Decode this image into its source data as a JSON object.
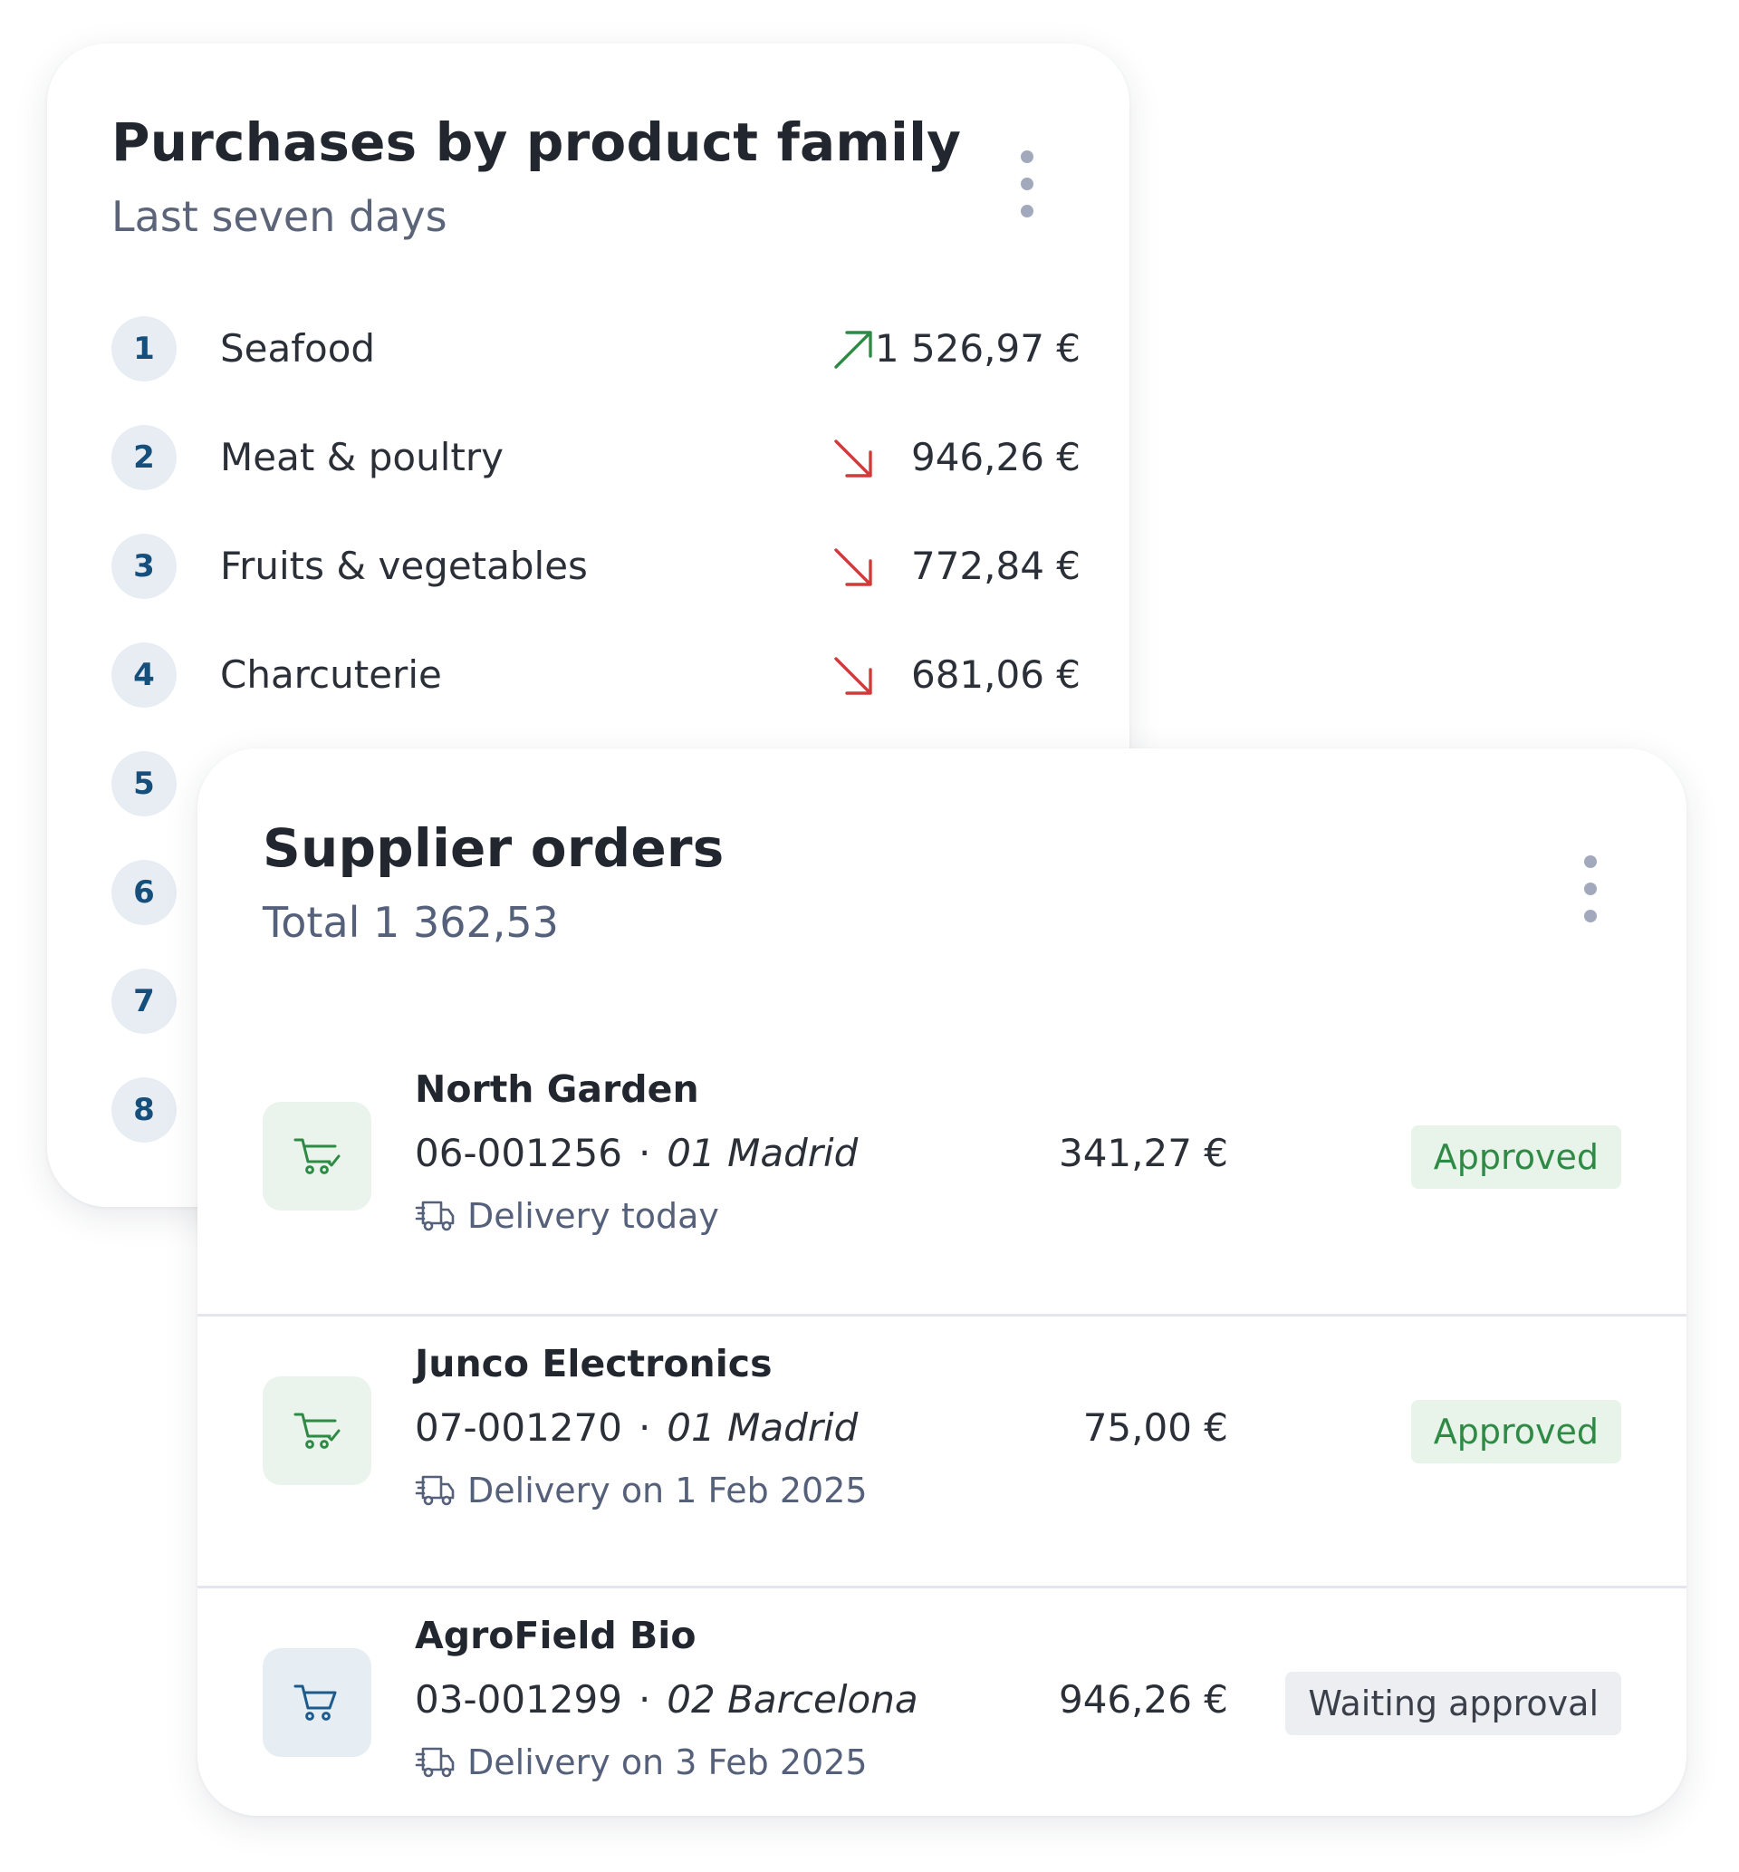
{
  "purchases": {
    "title": "Purchases by product family",
    "subtitle": "Last seven days",
    "items": [
      {
        "rank": "1",
        "name": "Seafood",
        "trend": "up",
        "amount": "1 526,97 €"
      },
      {
        "rank": "2",
        "name": "Meat & poultry",
        "trend": "down",
        "amount": "946,26 €"
      },
      {
        "rank": "3",
        "name": "Fruits & vegetables",
        "trend": "down",
        "amount": "772,84 €"
      },
      {
        "rank": "4",
        "name": "Charcuterie",
        "trend": "down",
        "amount": "681,06 €"
      },
      {
        "rank": "5"
      },
      {
        "rank": "6"
      },
      {
        "rank": "7"
      },
      {
        "rank": "8"
      }
    ]
  },
  "orders": {
    "title": "Supplier orders",
    "total": "Total 1 362,53",
    "items": [
      {
        "supplier": "North Garden",
        "number": "06-001256",
        "location": "01 Madrid",
        "delivery": "Delivery today",
        "amount": "341,27 €",
        "status": "Approved",
        "icon": "cart-check-icon"
      },
      {
        "supplier": "Junco Electronics",
        "number": "07-001270",
        "location": "01 Madrid",
        "delivery": "Delivery on 1 Feb 2025",
        "amount": "75,00 €",
        "status": "Approved",
        "icon": "cart-check-icon"
      },
      {
        "supplier": "AgroField Bio",
        "number": "03-001299",
        "location": "02 Barcelona",
        "delivery": "Delivery on 3 Feb 2025",
        "amount": "946,26 €",
        "status": "Waiting approval",
        "icon": "cart-icon"
      }
    ]
  },
  "separator": "·",
  "colors": {
    "trend_up": "#2e8a45",
    "trend_down": "#d23a3a",
    "approved_bg": "#e8f4ea",
    "approved_text": "#2e8a45",
    "waiting_bg": "#eceef2",
    "waiting_text": "#3a3f49",
    "rank_badge_bg": "#e8edf3",
    "rank_badge_text": "#164f7c"
  }
}
